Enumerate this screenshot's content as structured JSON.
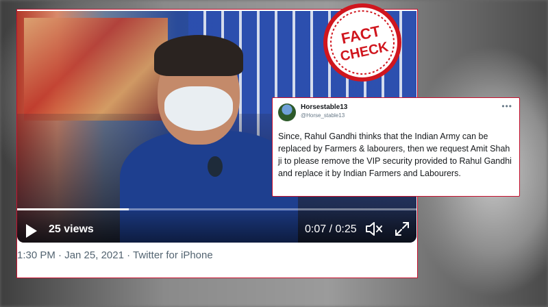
{
  "stamp": {
    "line1": "FACT",
    "line2": "CHECK",
    "color": "#d0161e"
  },
  "video": {
    "views": "25 views",
    "time": "0:07 / 0:25",
    "progress_fraction": 0.28
  },
  "tweet": {
    "meta": "1:30 PM · Jan 25, 2021 · Twitter for iPhone"
  },
  "quote": {
    "display_name": "Horsestable13",
    "handle": "@Horse_stable13",
    "more": "•••",
    "text": "Since, Rahul Gandhi thinks that the Indian Army can be replaced by Farmers & labourers, then we request Amit Shah ji to please remove the VIP security provided to Rahul Gandhi and replace it by Indian Farmers and Labourers."
  },
  "colors": {
    "border_accent": "#c8102e",
    "meta_gray": "#536471"
  },
  "icons": [
    "play-icon",
    "volume-icon",
    "fullscreen-icon",
    "more-icon"
  ]
}
